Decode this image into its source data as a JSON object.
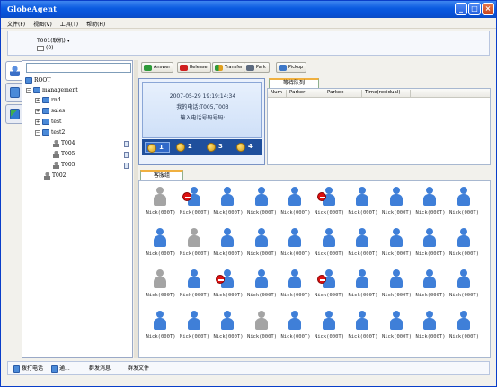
{
  "window": {
    "title": "GlobeAgent"
  },
  "menu": [
    "文件(F)",
    "视图(V)",
    "工具(T)",
    "帮助(H)"
  ],
  "status": {
    "extension": "T001(联机) ▾",
    "message_count": "(0)"
  },
  "tree": {
    "root": "ROOT",
    "nodes": [
      {
        "label": "management"
      },
      {
        "label": "rnd"
      },
      {
        "label": "sales"
      },
      {
        "label": "test"
      },
      {
        "label": "test2"
      },
      {
        "label": "T004"
      },
      {
        "label": "T005"
      },
      {
        "label": "T005"
      },
      {
        "label": "T002"
      }
    ]
  },
  "toolbar": {
    "answer": "Answer",
    "release": "Release",
    "transfer": "Transfer",
    "park": "Park",
    "pickup": "Pickup"
  },
  "phone": {
    "datetime": "2007-05-29 19:19:14:34",
    "my_number": "我的电话:T005,T003",
    "prompt": "输入电话号码号码:",
    "lines": [
      "1",
      "2",
      "3",
      "4"
    ]
  },
  "queue": {
    "tab": "等待队列",
    "columns": [
      "Num",
      "Parker",
      "Parkee",
      "Time(residual)"
    ]
  },
  "group": {
    "tab": "客服组",
    "agents": [
      {
        "name": "Nick(000T)",
        "state": "offline"
      },
      {
        "name": "Nick(000T)",
        "state": "busy"
      },
      {
        "name": "Nick(000T)",
        "state": "idle"
      },
      {
        "name": "Nick(000T)",
        "state": "idle"
      },
      {
        "name": "Nick(000T)",
        "state": "idle"
      },
      {
        "name": "Nick(000T)",
        "state": "busy"
      },
      {
        "name": "Nick(000T)",
        "state": "idle"
      },
      {
        "name": "Nick(000T)",
        "state": "idle"
      },
      {
        "name": "Nick(000T)",
        "state": "idle"
      },
      {
        "name": "Nick(000T)",
        "state": "idle"
      },
      {
        "name": "Nick(000T)",
        "state": "idle"
      },
      {
        "name": "Nick(000T)",
        "state": "offline"
      },
      {
        "name": "Nick(000T)",
        "state": "idle"
      },
      {
        "name": "Nick(000T)",
        "state": "idle"
      },
      {
        "name": "Nick(000T)",
        "state": "idle"
      },
      {
        "name": "Nick(000T)",
        "state": "idle"
      },
      {
        "name": "Nick(000T)",
        "state": "idle"
      },
      {
        "name": "Nick(000T)",
        "state": "idle"
      },
      {
        "name": "Nick(000T)",
        "state": "idle"
      },
      {
        "name": "Nick(000T)",
        "state": "idle"
      },
      {
        "name": "Nick(000T)",
        "state": "offline"
      },
      {
        "name": "Nick(000T)",
        "state": "idle"
      },
      {
        "name": "Nick(000T)",
        "state": "busy"
      },
      {
        "name": "Nick(000T)",
        "state": "idle"
      },
      {
        "name": "Nick(000T)",
        "state": "idle"
      },
      {
        "name": "Nick(000T)",
        "state": "busy"
      },
      {
        "name": "Nick(000T)",
        "state": "idle"
      },
      {
        "name": "Nick(000T)",
        "state": "idle"
      },
      {
        "name": "Nick(000T)",
        "state": "idle"
      },
      {
        "name": "Nick(000T)",
        "state": "idle"
      },
      {
        "name": "Nick(000T)",
        "state": "idle"
      },
      {
        "name": "Nick(000T)",
        "state": "idle"
      },
      {
        "name": "Nick(000T)",
        "state": "idle"
      },
      {
        "name": "Nick(000T)",
        "state": "offline"
      },
      {
        "name": "Nick(000T)",
        "state": "idle"
      },
      {
        "name": "Nick(000T)",
        "state": "idle"
      },
      {
        "name": "Nick(000T)",
        "state": "idle"
      },
      {
        "name": "Nick(000T)",
        "state": "idle"
      },
      {
        "name": "Nick(000T)",
        "state": "idle"
      },
      {
        "name": "Nick(000T)",
        "state": "idle"
      }
    ]
  },
  "bottom": {
    "call": "拨打电话",
    "more": "通...",
    "broadcast_msg": "群发消息",
    "broadcast_file": "群发文件"
  },
  "colors": {
    "idle": "#3f7fd8",
    "offline": "#a4a4a4",
    "busy": "#d11111",
    "title_bar": "#0a5ae0"
  }
}
